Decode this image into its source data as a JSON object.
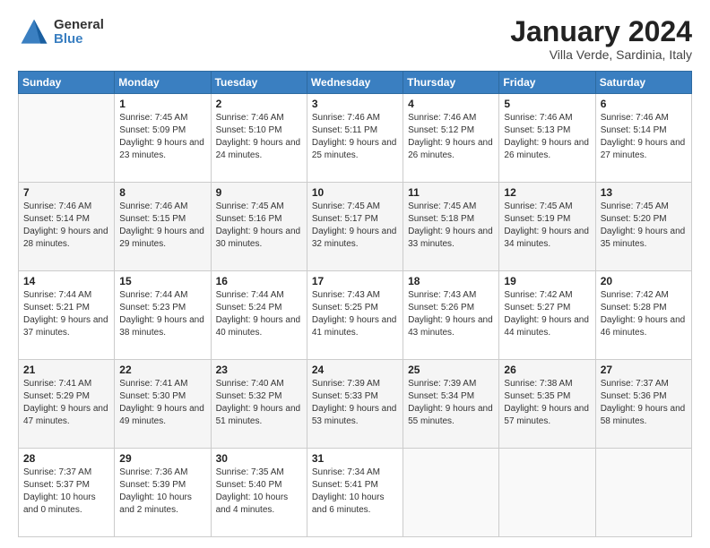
{
  "header": {
    "logo_general": "General",
    "logo_blue": "Blue",
    "title": "January 2024",
    "subtitle": "Villa Verde, Sardinia, Italy"
  },
  "days_of_week": [
    "Sunday",
    "Monday",
    "Tuesday",
    "Wednesday",
    "Thursday",
    "Friday",
    "Saturday"
  ],
  "weeks": [
    [
      {
        "num": "",
        "sunrise": "",
        "sunset": "",
        "daylight": "",
        "empty": true
      },
      {
        "num": "1",
        "sunrise": "Sunrise: 7:45 AM",
        "sunset": "Sunset: 5:09 PM",
        "daylight": "Daylight: 9 hours and 23 minutes."
      },
      {
        "num": "2",
        "sunrise": "Sunrise: 7:46 AM",
        "sunset": "Sunset: 5:10 PM",
        "daylight": "Daylight: 9 hours and 24 minutes."
      },
      {
        "num": "3",
        "sunrise": "Sunrise: 7:46 AM",
        "sunset": "Sunset: 5:11 PM",
        "daylight": "Daylight: 9 hours and 25 minutes."
      },
      {
        "num": "4",
        "sunrise": "Sunrise: 7:46 AM",
        "sunset": "Sunset: 5:12 PM",
        "daylight": "Daylight: 9 hours and 26 minutes."
      },
      {
        "num": "5",
        "sunrise": "Sunrise: 7:46 AM",
        "sunset": "Sunset: 5:13 PM",
        "daylight": "Daylight: 9 hours and 26 minutes."
      },
      {
        "num": "6",
        "sunrise": "Sunrise: 7:46 AM",
        "sunset": "Sunset: 5:14 PM",
        "daylight": "Daylight: 9 hours and 27 minutes."
      }
    ],
    [
      {
        "num": "7",
        "sunrise": "Sunrise: 7:46 AM",
        "sunset": "Sunset: 5:14 PM",
        "daylight": "Daylight: 9 hours and 28 minutes."
      },
      {
        "num": "8",
        "sunrise": "Sunrise: 7:46 AM",
        "sunset": "Sunset: 5:15 PM",
        "daylight": "Daylight: 9 hours and 29 minutes."
      },
      {
        "num": "9",
        "sunrise": "Sunrise: 7:45 AM",
        "sunset": "Sunset: 5:16 PM",
        "daylight": "Daylight: 9 hours and 30 minutes."
      },
      {
        "num": "10",
        "sunrise": "Sunrise: 7:45 AM",
        "sunset": "Sunset: 5:17 PM",
        "daylight": "Daylight: 9 hours and 32 minutes."
      },
      {
        "num": "11",
        "sunrise": "Sunrise: 7:45 AM",
        "sunset": "Sunset: 5:18 PM",
        "daylight": "Daylight: 9 hours and 33 minutes."
      },
      {
        "num": "12",
        "sunrise": "Sunrise: 7:45 AM",
        "sunset": "Sunset: 5:19 PM",
        "daylight": "Daylight: 9 hours and 34 minutes."
      },
      {
        "num": "13",
        "sunrise": "Sunrise: 7:45 AM",
        "sunset": "Sunset: 5:20 PM",
        "daylight": "Daylight: 9 hours and 35 minutes."
      }
    ],
    [
      {
        "num": "14",
        "sunrise": "Sunrise: 7:44 AM",
        "sunset": "Sunset: 5:21 PM",
        "daylight": "Daylight: 9 hours and 37 minutes."
      },
      {
        "num": "15",
        "sunrise": "Sunrise: 7:44 AM",
        "sunset": "Sunset: 5:23 PM",
        "daylight": "Daylight: 9 hours and 38 minutes."
      },
      {
        "num": "16",
        "sunrise": "Sunrise: 7:44 AM",
        "sunset": "Sunset: 5:24 PM",
        "daylight": "Daylight: 9 hours and 40 minutes."
      },
      {
        "num": "17",
        "sunrise": "Sunrise: 7:43 AM",
        "sunset": "Sunset: 5:25 PM",
        "daylight": "Daylight: 9 hours and 41 minutes."
      },
      {
        "num": "18",
        "sunrise": "Sunrise: 7:43 AM",
        "sunset": "Sunset: 5:26 PM",
        "daylight": "Daylight: 9 hours and 43 minutes."
      },
      {
        "num": "19",
        "sunrise": "Sunrise: 7:42 AM",
        "sunset": "Sunset: 5:27 PM",
        "daylight": "Daylight: 9 hours and 44 minutes."
      },
      {
        "num": "20",
        "sunrise": "Sunrise: 7:42 AM",
        "sunset": "Sunset: 5:28 PM",
        "daylight": "Daylight: 9 hours and 46 minutes."
      }
    ],
    [
      {
        "num": "21",
        "sunrise": "Sunrise: 7:41 AM",
        "sunset": "Sunset: 5:29 PM",
        "daylight": "Daylight: 9 hours and 47 minutes."
      },
      {
        "num": "22",
        "sunrise": "Sunrise: 7:41 AM",
        "sunset": "Sunset: 5:30 PM",
        "daylight": "Daylight: 9 hours and 49 minutes."
      },
      {
        "num": "23",
        "sunrise": "Sunrise: 7:40 AM",
        "sunset": "Sunset: 5:32 PM",
        "daylight": "Daylight: 9 hours and 51 minutes."
      },
      {
        "num": "24",
        "sunrise": "Sunrise: 7:39 AM",
        "sunset": "Sunset: 5:33 PM",
        "daylight": "Daylight: 9 hours and 53 minutes."
      },
      {
        "num": "25",
        "sunrise": "Sunrise: 7:39 AM",
        "sunset": "Sunset: 5:34 PM",
        "daylight": "Daylight: 9 hours and 55 minutes."
      },
      {
        "num": "26",
        "sunrise": "Sunrise: 7:38 AM",
        "sunset": "Sunset: 5:35 PM",
        "daylight": "Daylight: 9 hours and 57 minutes."
      },
      {
        "num": "27",
        "sunrise": "Sunrise: 7:37 AM",
        "sunset": "Sunset: 5:36 PM",
        "daylight": "Daylight: 9 hours and 58 minutes."
      }
    ],
    [
      {
        "num": "28",
        "sunrise": "Sunrise: 7:37 AM",
        "sunset": "Sunset: 5:37 PM",
        "daylight": "Daylight: 10 hours and 0 minutes."
      },
      {
        "num": "29",
        "sunrise": "Sunrise: 7:36 AM",
        "sunset": "Sunset: 5:39 PM",
        "daylight": "Daylight: 10 hours and 2 minutes."
      },
      {
        "num": "30",
        "sunrise": "Sunrise: 7:35 AM",
        "sunset": "Sunset: 5:40 PM",
        "daylight": "Daylight: 10 hours and 4 minutes."
      },
      {
        "num": "31",
        "sunrise": "Sunrise: 7:34 AM",
        "sunset": "Sunset: 5:41 PM",
        "daylight": "Daylight: 10 hours and 6 minutes."
      },
      {
        "num": "",
        "sunrise": "",
        "sunset": "",
        "daylight": "",
        "empty": true
      },
      {
        "num": "",
        "sunrise": "",
        "sunset": "",
        "daylight": "",
        "empty": true
      },
      {
        "num": "",
        "sunrise": "",
        "sunset": "",
        "daylight": "",
        "empty": true
      }
    ]
  ]
}
